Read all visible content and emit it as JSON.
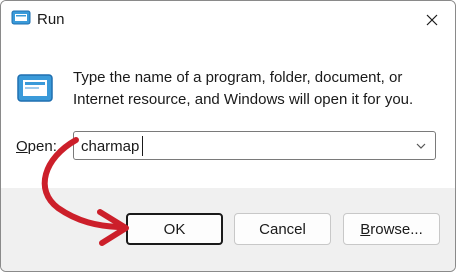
{
  "window": {
    "title": "Run",
    "title_icon": "run-icon",
    "close_icon": "close-icon"
  },
  "body": {
    "description": "Type the name of a program, folder, document, or Internet resource, and Windows will open it for you.",
    "open_label_prefix": "O",
    "open_label_rest": "pen:",
    "open_value": "charmap"
  },
  "buttons": {
    "ok_label": "OK",
    "cancel_label": "Cancel",
    "browse_prefix": "B",
    "browse_rest": "rowse..."
  },
  "colors": {
    "accent": "#2b88d8",
    "annotation_arrow": "#cc1f2a",
    "footer_bg": "#f0f0f0"
  }
}
